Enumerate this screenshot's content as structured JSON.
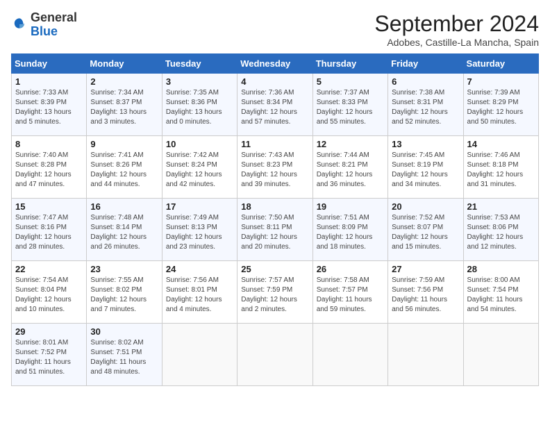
{
  "header": {
    "logo_general": "General",
    "logo_blue": "Blue",
    "month": "September 2024",
    "location": "Adobes, Castille-La Mancha, Spain"
  },
  "columns": [
    "Sunday",
    "Monday",
    "Tuesday",
    "Wednesday",
    "Thursday",
    "Friday",
    "Saturday"
  ],
  "weeks": [
    [
      {
        "day": "1",
        "info": "Sunrise: 7:33 AM\nSunset: 8:39 PM\nDaylight: 13 hours\nand 5 minutes."
      },
      {
        "day": "2",
        "info": "Sunrise: 7:34 AM\nSunset: 8:37 PM\nDaylight: 13 hours\nand 3 minutes."
      },
      {
        "day": "3",
        "info": "Sunrise: 7:35 AM\nSunset: 8:36 PM\nDaylight: 13 hours\nand 0 minutes."
      },
      {
        "day": "4",
        "info": "Sunrise: 7:36 AM\nSunset: 8:34 PM\nDaylight: 12 hours\nand 57 minutes."
      },
      {
        "day": "5",
        "info": "Sunrise: 7:37 AM\nSunset: 8:33 PM\nDaylight: 12 hours\nand 55 minutes."
      },
      {
        "day": "6",
        "info": "Sunrise: 7:38 AM\nSunset: 8:31 PM\nDaylight: 12 hours\nand 52 minutes."
      },
      {
        "day": "7",
        "info": "Sunrise: 7:39 AM\nSunset: 8:29 PM\nDaylight: 12 hours\nand 50 minutes."
      }
    ],
    [
      {
        "day": "8",
        "info": "Sunrise: 7:40 AM\nSunset: 8:28 PM\nDaylight: 12 hours\nand 47 minutes."
      },
      {
        "day": "9",
        "info": "Sunrise: 7:41 AM\nSunset: 8:26 PM\nDaylight: 12 hours\nand 44 minutes."
      },
      {
        "day": "10",
        "info": "Sunrise: 7:42 AM\nSunset: 8:24 PM\nDaylight: 12 hours\nand 42 minutes."
      },
      {
        "day": "11",
        "info": "Sunrise: 7:43 AM\nSunset: 8:23 PM\nDaylight: 12 hours\nand 39 minutes."
      },
      {
        "day": "12",
        "info": "Sunrise: 7:44 AM\nSunset: 8:21 PM\nDaylight: 12 hours\nand 36 minutes."
      },
      {
        "day": "13",
        "info": "Sunrise: 7:45 AM\nSunset: 8:19 PM\nDaylight: 12 hours\nand 34 minutes."
      },
      {
        "day": "14",
        "info": "Sunrise: 7:46 AM\nSunset: 8:18 PM\nDaylight: 12 hours\nand 31 minutes."
      }
    ],
    [
      {
        "day": "15",
        "info": "Sunrise: 7:47 AM\nSunset: 8:16 PM\nDaylight: 12 hours\nand 28 minutes."
      },
      {
        "day": "16",
        "info": "Sunrise: 7:48 AM\nSunset: 8:14 PM\nDaylight: 12 hours\nand 26 minutes."
      },
      {
        "day": "17",
        "info": "Sunrise: 7:49 AM\nSunset: 8:13 PM\nDaylight: 12 hours\nand 23 minutes."
      },
      {
        "day": "18",
        "info": "Sunrise: 7:50 AM\nSunset: 8:11 PM\nDaylight: 12 hours\nand 20 minutes."
      },
      {
        "day": "19",
        "info": "Sunrise: 7:51 AM\nSunset: 8:09 PM\nDaylight: 12 hours\nand 18 minutes."
      },
      {
        "day": "20",
        "info": "Sunrise: 7:52 AM\nSunset: 8:07 PM\nDaylight: 12 hours\nand 15 minutes."
      },
      {
        "day": "21",
        "info": "Sunrise: 7:53 AM\nSunset: 8:06 PM\nDaylight: 12 hours\nand 12 minutes."
      }
    ],
    [
      {
        "day": "22",
        "info": "Sunrise: 7:54 AM\nSunset: 8:04 PM\nDaylight: 12 hours\nand 10 minutes."
      },
      {
        "day": "23",
        "info": "Sunrise: 7:55 AM\nSunset: 8:02 PM\nDaylight: 12 hours\nand 7 minutes."
      },
      {
        "day": "24",
        "info": "Sunrise: 7:56 AM\nSunset: 8:01 PM\nDaylight: 12 hours\nand 4 minutes."
      },
      {
        "day": "25",
        "info": "Sunrise: 7:57 AM\nSunset: 7:59 PM\nDaylight: 12 hours\nand 2 minutes."
      },
      {
        "day": "26",
        "info": "Sunrise: 7:58 AM\nSunset: 7:57 PM\nDaylight: 11 hours\nand 59 minutes."
      },
      {
        "day": "27",
        "info": "Sunrise: 7:59 AM\nSunset: 7:56 PM\nDaylight: 11 hours\nand 56 minutes."
      },
      {
        "day": "28",
        "info": "Sunrise: 8:00 AM\nSunset: 7:54 PM\nDaylight: 11 hours\nand 54 minutes."
      }
    ],
    [
      {
        "day": "29",
        "info": "Sunrise: 8:01 AM\nSunset: 7:52 PM\nDaylight: 11 hours\nand 51 minutes."
      },
      {
        "day": "30",
        "info": "Sunrise: 8:02 AM\nSunset: 7:51 PM\nDaylight: 11 hours\nand 48 minutes."
      },
      {
        "day": "",
        "info": ""
      },
      {
        "day": "",
        "info": ""
      },
      {
        "day": "",
        "info": ""
      },
      {
        "day": "",
        "info": ""
      },
      {
        "day": "",
        "info": ""
      }
    ]
  ]
}
